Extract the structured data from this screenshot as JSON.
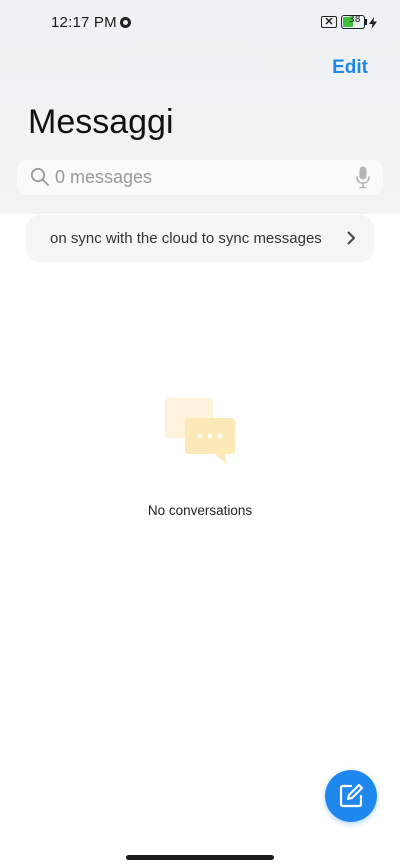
{
  "status_bar": {
    "time": "12:17 PM",
    "battery_level": "38",
    "battery_color": "#3cc13b"
  },
  "header": {
    "edit_label": "Edit",
    "title": "Messaggi"
  },
  "search": {
    "placeholder": "0 messages"
  },
  "sync_banner": {
    "text": "on sync with the cloud to sync messages"
  },
  "empty_state": {
    "text": "No conversations"
  },
  "colors": {
    "accent": "#1e88e5",
    "empty_icon": "#fde9b8"
  },
  "icons": [
    "search-icon",
    "microphone-icon",
    "chevron-right-icon",
    "chat-bubbles-icon",
    "compose-icon"
  ]
}
